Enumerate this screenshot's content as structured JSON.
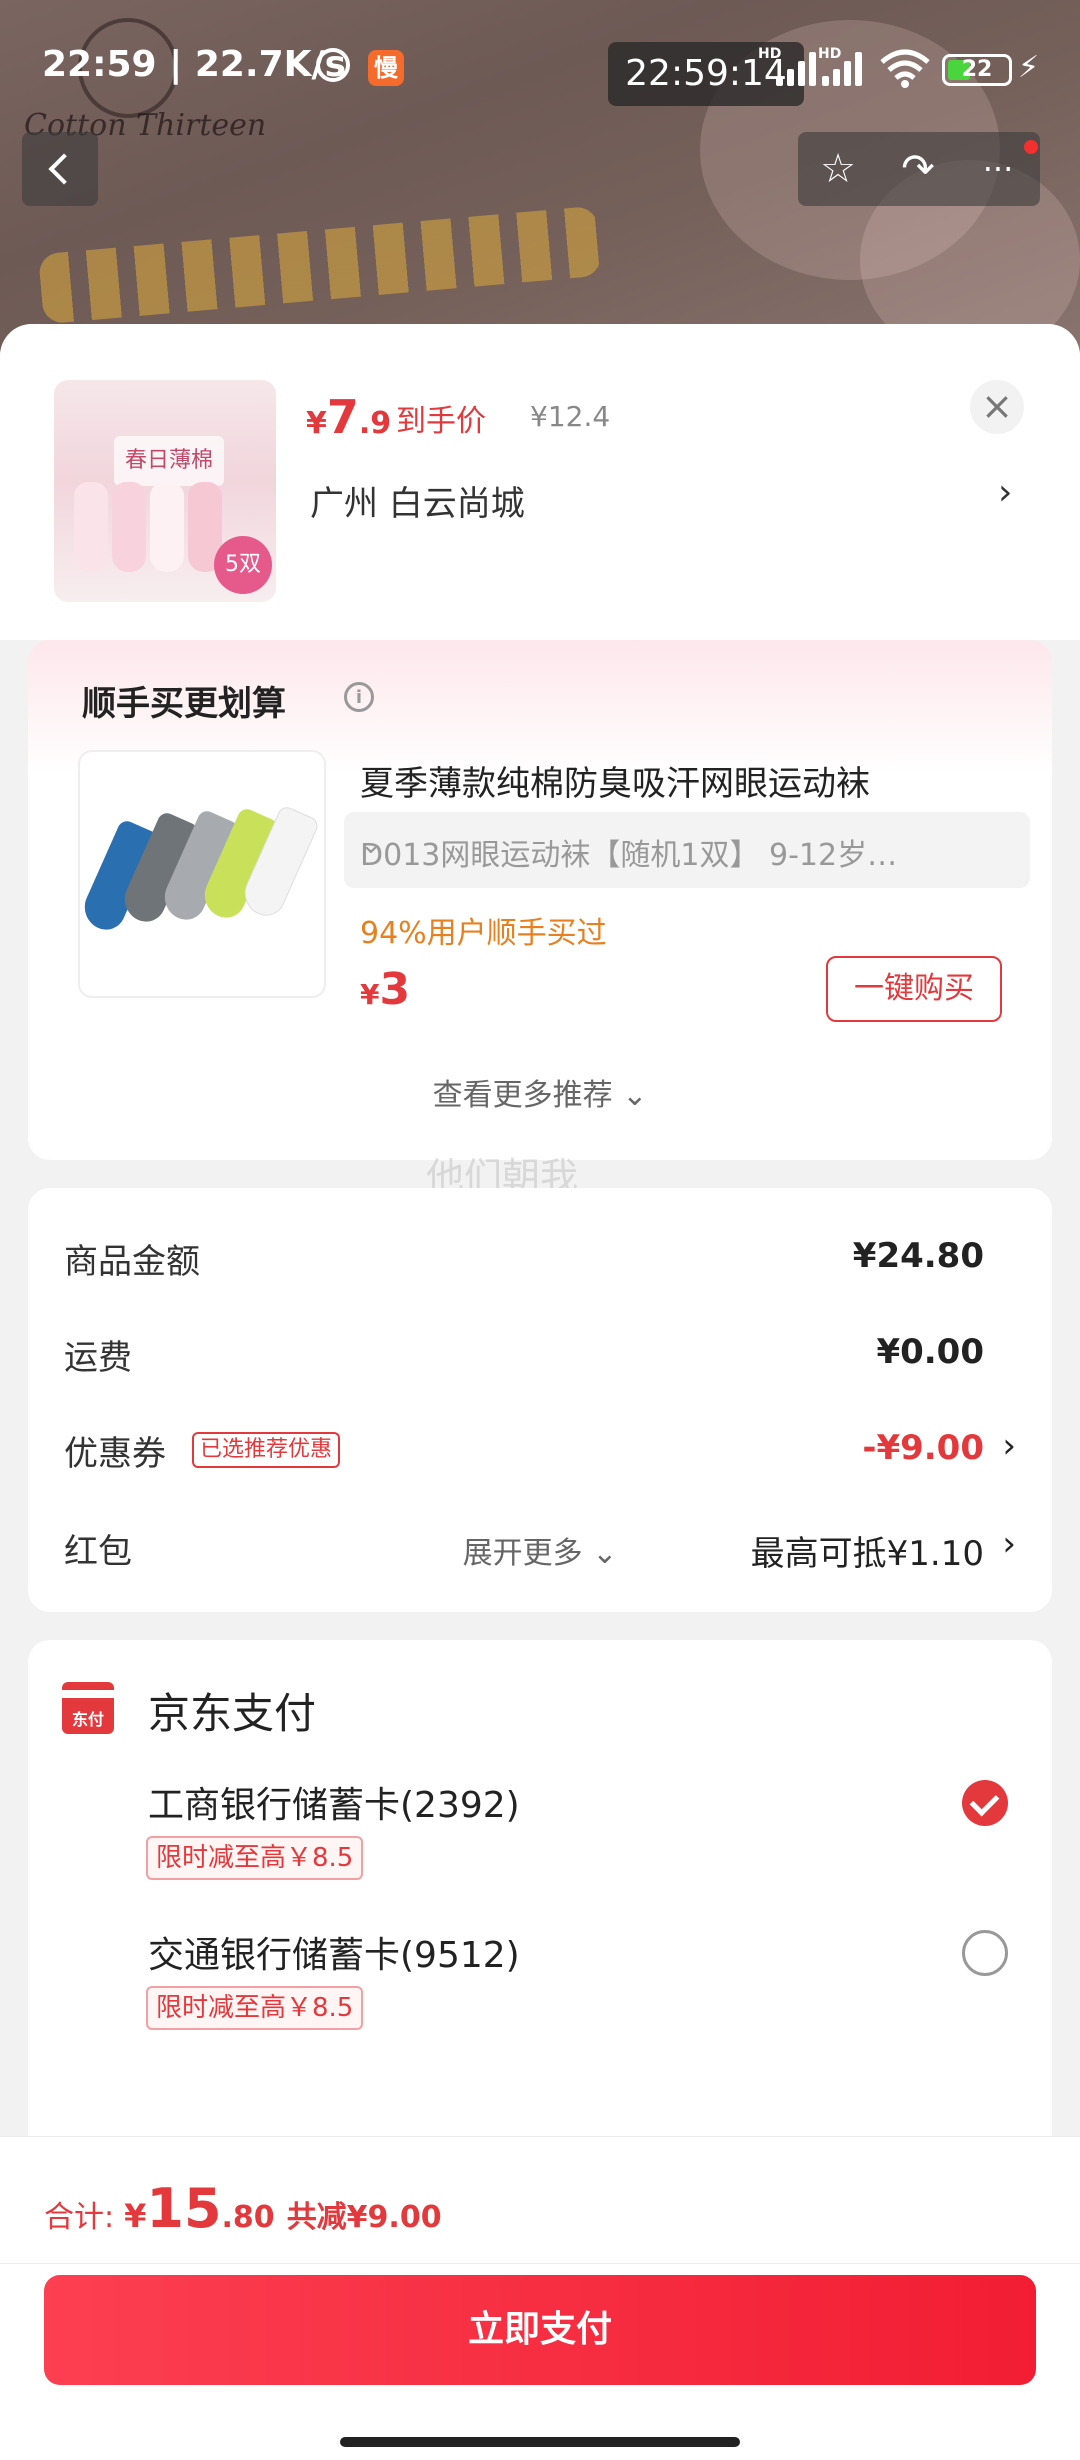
{
  "status_bar": {
    "time": "22:59",
    "speed": "22.7K/s",
    "slow_badge": "慢",
    "clock_overlay": "22:59:14",
    "hd_label_1": "HD",
    "hd_label_2": "HD",
    "battery_level": "22",
    "bolt": "⚡"
  },
  "background": {
    "brand_text": "Cotton Thirteen"
  },
  "nav": {
    "back_glyph": "",
    "favorite_glyph": "☆",
    "share_glyph": "↷",
    "more_glyph": "···"
  },
  "product": {
    "image_tag": "春日薄棉",
    "image_count": "5双",
    "price_currency": "¥",
    "price_int": "7",
    "price_dec": ".9",
    "price_label": "到手价",
    "original_price": "¥12.4",
    "address": "广州  白云尚城",
    "address_arrow": "›",
    "close_glyph": "×"
  },
  "recommend": {
    "title": "顺手买更划算",
    "info_glyph": "i",
    "item_name": "夏季薄款纯棉防臭吸汗网眼运动袜",
    "spec": "D013网眼运动袜【随机1双】   9-12岁…",
    "spec_chevron": "⌄",
    "buyers": "94%用户顺手买过",
    "price_currency": "¥",
    "price_int": "3",
    "buy_button": "一键购买",
    "more": "查看更多推荐 ⌄",
    "sock_colors": [
      "#2a6fb0",
      "#6f7478",
      "#a7aaae",
      "#c8e05a",
      "#f4f4f4"
    ]
  },
  "watermark": "他们朝我",
  "amount": {
    "goods_label": "商品金额",
    "goods_value": "¥24.80",
    "shipping_label": "运费",
    "shipping_value": "¥0.00",
    "coupon_label": "优惠券",
    "coupon_badge": "已选推荐优惠",
    "coupon_value": "-¥9.00",
    "redpacket_label": "红包",
    "redpacket_value": "最高可抵¥1.10",
    "arrow": "›",
    "expand": "展开更多 ⌄"
  },
  "payment": {
    "method_title": "京东支付",
    "icon_text": "东付",
    "cards": [
      {
        "name": "工商银行储蓄卡(2392)",
        "promo": "限时减至高￥8.5",
        "selected": true
      },
      {
        "name": "交通银行储蓄卡(9512)",
        "promo": "限时减至高￥8.5",
        "selected": false
      }
    ]
  },
  "bottom_bar": {
    "total_label": "合计:",
    "total_currency": "¥",
    "total_int": "15",
    "total_dec": ".80",
    "total_saved": "共减¥9.00",
    "pay_button": "立即支付"
  }
}
